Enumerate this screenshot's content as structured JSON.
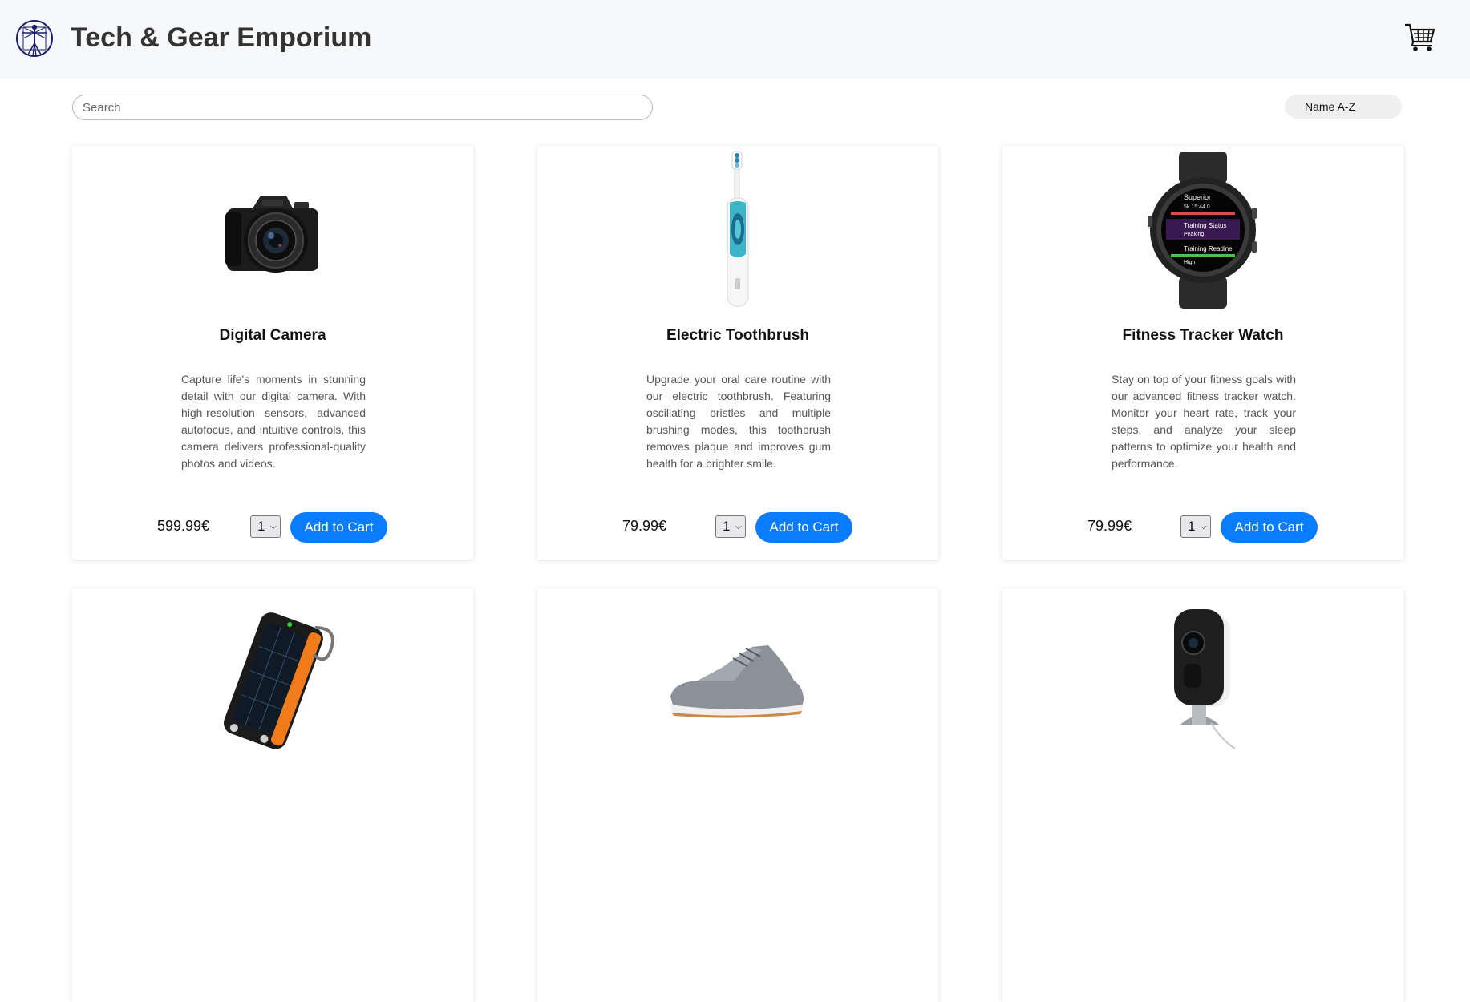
{
  "header": {
    "title": "Tech & Gear Emporium",
    "logo_icon": "vitruvian-man-logo",
    "cart_icon": "shopping-cart-icon"
  },
  "toolbar": {
    "search_placeholder": "Search",
    "sort_value": "Name A-Z"
  },
  "colors": {
    "header_bg": "#f7f8fa",
    "accent": "#0a7cff"
  },
  "products": [
    {
      "name": "Digital Camera",
      "description": "Capture life's moments in stunning detail with our digital camera. With high-resolution sensors, advanced autofocus, and intuitive controls, this camera delivers professional-quality photos and videos.",
      "price": "599.99€",
      "qty": "1",
      "button": "Add to Cart",
      "image_icon": "camera-image"
    },
    {
      "name": "Electric Toothbrush",
      "description": "Upgrade your oral care routine with our electric toothbrush. Featuring oscillating bristles and multiple brushing modes, this toothbrush removes plaque and improves gum health for a brighter smile.",
      "price": "79.99€",
      "qty": "1",
      "button": "Add to Cart",
      "image_icon": "toothbrush-image"
    },
    {
      "name": "Fitness Tracker Watch",
      "description": "Stay on top of your fitness goals with our advanced fitness tracker watch. Monitor your heart rate, track your steps, and analyze your sleep patterns to optimize your health and performance.",
      "price": "79.99€",
      "qty": "1",
      "button": "Add to Cart",
      "image_icon": "smartwatch-image",
      "watch_screen": [
        "Superior",
        "5k 15:44.0",
        "Training Status",
        "Peaking",
        "Training Readine",
        "High"
      ]
    },
    {
      "image_icon": "solar-power-bank-image"
    },
    {
      "image_icon": "sneaker-image"
    },
    {
      "image_icon": "security-camera-image"
    }
  ]
}
